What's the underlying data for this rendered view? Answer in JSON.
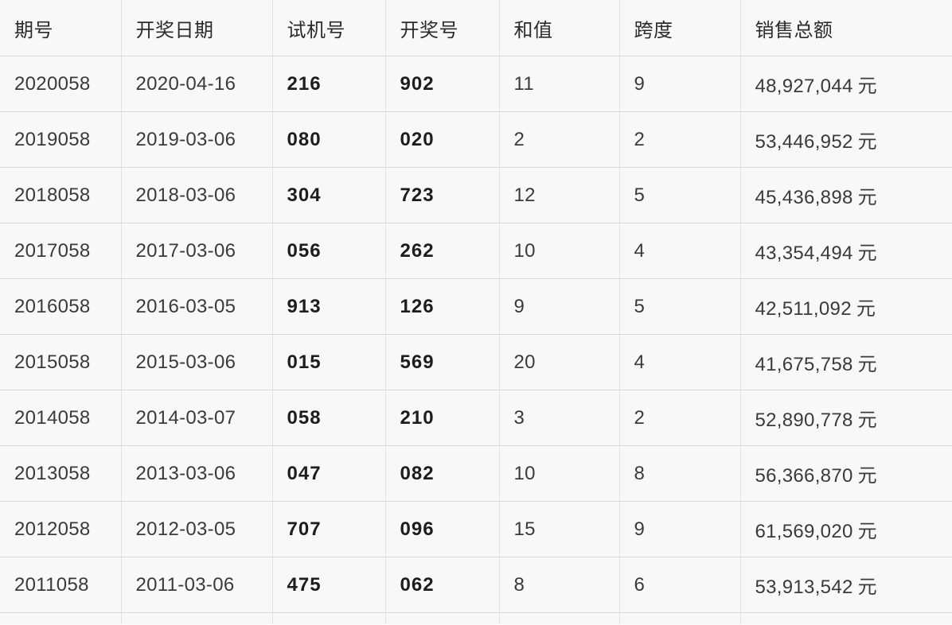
{
  "table": {
    "columns": [
      {
        "key": "issue",
        "label": "期号"
      },
      {
        "key": "date",
        "label": "开奖日期"
      },
      {
        "key": "test",
        "label": "试机号"
      },
      {
        "key": "draw",
        "label": "开奖号"
      },
      {
        "key": "sum",
        "label": "和值"
      },
      {
        "key": "span",
        "label": "跨度"
      },
      {
        "key": "sales",
        "label": "销售总额"
      }
    ],
    "sales_unit": "元",
    "rows": [
      {
        "issue": "2020058",
        "date": "2020-04-16",
        "test": "216",
        "draw": "902",
        "sum": "11",
        "span": "9",
        "sales": "48,927,044"
      },
      {
        "issue": "2019058",
        "date": "2019-03-06",
        "test": "080",
        "draw": "020",
        "sum": "2",
        "span": "2",
        "sales": "53,446,952"
      },
      {
        "issue": "2018058",
        "date": "2018-03-06",
        "test": "304",
        "draw": "723",
        "sum": "12",
        "span": "5",
        "sales": "45,436,898"
      },
      {
        "issue": "2017058",
        "date": "2017-03-06",
        "test": "056",
        "draw": "262",
        "sum": "10",
        "span": "4",
        "sales": "43,354,494"
      },
      {
        "issue": "2016058",
        "date": "2016-03-05",
        "test": "913",
        "draw": "126",
        "sum": "9",
        "span": "5",
        "sales": "42,511,092"
      },
      {
        "issue": "2015058",
        "date": "2015-03-06",
        "test": "015",
        "draw": "569",
        "sum": "20",
        "span": "4",
        "sales": "41,675,758"
      },
      {
        "issue": "2014058",
        "date": "2014-03-07",
        "test": "058",
        "draw": "210",
        "sum": "3",
        "span": "2",
        "sales": "52,890,778"
      },
      {
        "issue": "2013058",
        "date": "2013-03-06",
        "test": "047",
        "draw": "082",
        "sum": "10",
        "span": "8",
        "sales": "56,366,870"
      },
      {
        "issue": "2012058",
        "date": "2012-03-05",
        "test": "707",
        "draw": "096",
        "sum": "15",
        "span": "9",
        "sales": "61,569,020"
      },
      {
        "issue": "2011058",
        "date": "2011-03-06",
        "test": "475",
        "draw": "062",
        "sum": "8",
        "span": "6",
        "sales": "53,913,542"
      }
    ]
  },
  "colors": {
    "cell_background": "#f8f8f9",
    "border": "#d9d9dd",
    "text": "#3a3a3a",
    "text_strong": "#1d1d1d",
    "header_text": "#2b2b2b"
  }
}
